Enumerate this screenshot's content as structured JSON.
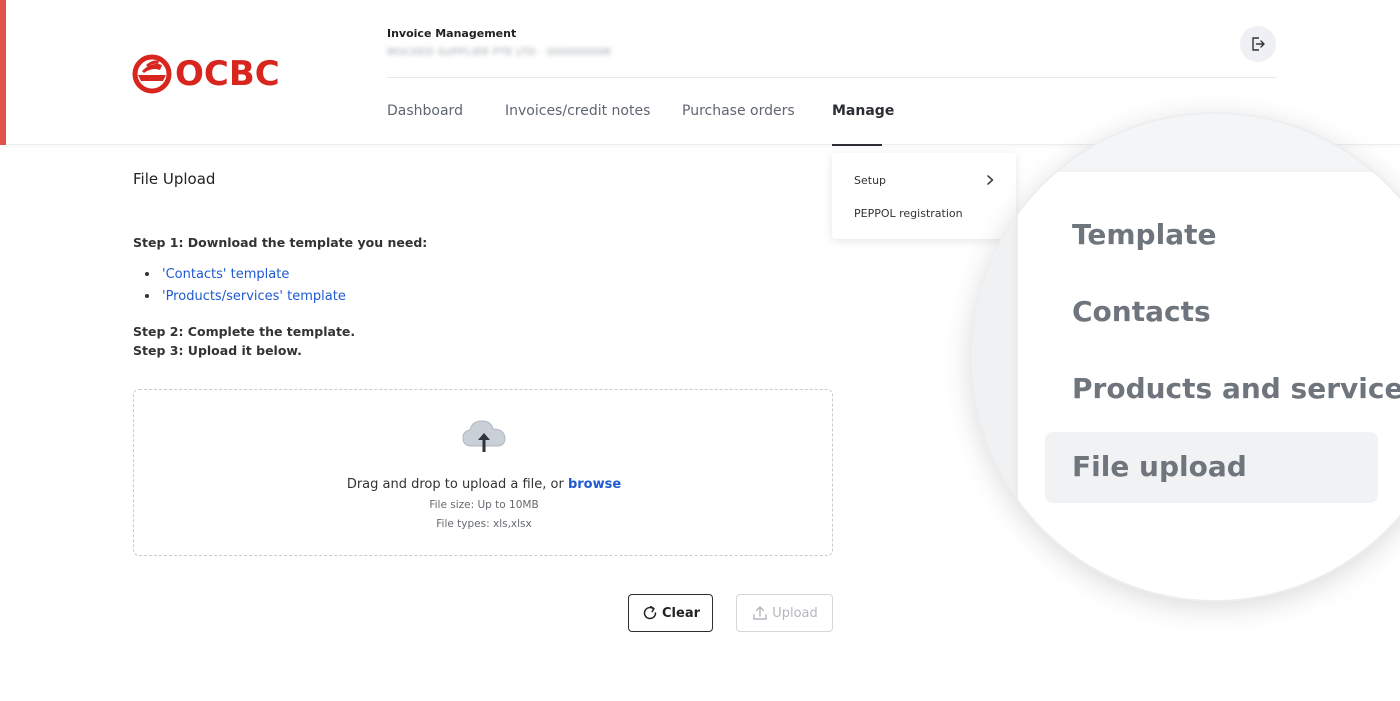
{
  "brand": {
    "logo_text": "OCBC",
    "accent_color": "#e0524a",
    "logo_color": "#d8251d"
  },
  "header": {
    "app_title": "Invoice Management",
    "company_line": "MOCKED SUPPLIER PTE LTD · 00000000M",
    "logout_icon": "logout-icon"
  },
  "nav": {
    "items": [
      {
        "label": "Dashboard",
        "active": false
      },
      {
        "label": "Invoices/credit notes",
        "active": false
      },
      {
        "label": "Purchase orders",
        "active": false
      },
      {
        "label": "Manage",
        "active": true
      }
    ]
  },
  "dropdown": {
    "items": [
      {
        "label": "Setup",
        "has_submenu": true
      },
      {
        "label": "PEPPOL registration",
        "has_submenu": false
      }
    ]
  },
  "page": {
    "title": "File Upload",
    "step1": "Step 1: Download the template you need:",
    "templates": [
      "'Contacts' template",
      "'Products/services' template"
    ],
    "step2": "Step 2: Complete the template.",
    "step3": "Step 3: Upload it below."
  },
  "dropzone": {
    "icon": "cloud-upload-icon",
    "text": "Drag and drop to upload a file, or ",
    "browse": "browse",
    "file_size": "File size: Up to 10MB",
    "file_types": "File types: xls,xlsx"
  },
  "buttons": {
    "clear": "Clear",
    "upload": "Upload",
    "upload_disabled": true
  },
  "magnifier": {
    "items": [
      {
        "label": "Template",
        "active": false
      },
      {
        "label": "Contacts",
        "active": false
      },
      {
        "label": "Products and services",
        "active": false
      },
      {
        "label": "File upload",
        "active": true
      }
    ]
  },
  "colors": {
    "link": "#1f5ad1",
    "text": "#333333",
    "muted": "#666a70"
  }
}
